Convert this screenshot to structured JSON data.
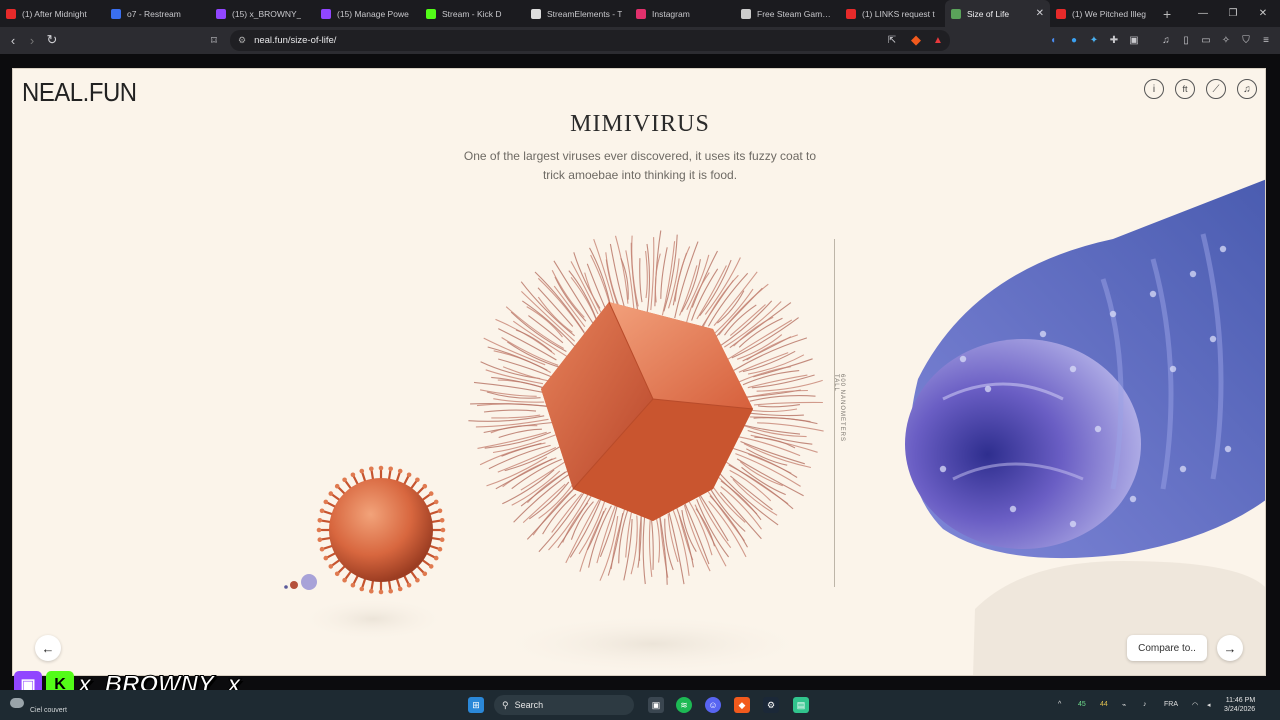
{
  "tabs": [
    {
      "label": "(1) After Midnight",
      "fav": "#e62a2a",
      "active": false
    },
    {
      "label": "o7 - Restream",
      "fav": "#3a6ff0",
      "active": false
    },
    {
      "label": "(15) x_BROWNY_",
      "fav": "#9146ff",
      "active": false
    },
    {
      "label": "(15) Manage Powe",
      "fav": "#9146ff",
      "active": false
    },
    {
      "label": "Stream - Kick D",
      "fav": "#53fc18",
      "active": false
    },
    {
      "label": "StreamElements - T",
      "fav": "#dddddd",
      "active": false
    },
    {
      "label": "Instagram",
      "fav": "#e1306c",
      "active": false
    },
    {
      "label": "Free Steam Game P",
      "fav": "#cccccc",
      "active": false
    },
    {
      "label": "(1) LINKS request t",
      "fav": "#e62a2a",
      "active": false
    },
    {
      "label": "Size of Life",
      "fav": "#5aa35a",
      "active": true
    },
    {
      "label": "(1) We Pitched Illeg",
      "fav": "#e62a2a",
      "active": false
    }
  ],
  "address": {
    "url": "neal.fun/size-of-life/"
  },
  "page": {
    "logo": "NEAL.FUN",
    "title": "MIMIVIRUS",
    "description": "One of the largest viruses ever discovered, it uses its fuzzy coat to trick amoebae into thinking it is food.",
    "scale_label": "600 NANOMETERS TALL",
    "compare_label": "Compare to..",
    "prev_icon": "←",
    "next_icon": "→"
  },
  "overlay": {
    "name": "x_BROWNY_x",
    "twitch_glyph": "▣",
    "kick_glyph": "K"
  },
  "taskbar": {
    "weather": "Ciel couvert",
    "search_label": "Search",
    "lang": "FRA",
    "time": "11:46 PM",
    "date": "3/24/2026",
    "tray_a": "45",
    "tray_b": "44"
  },
  "colors": {
    "accent_virus": "#e0714a",
    "mitochondria": "#5f63c8",
    "page_bg": "#fbf4ea"
  }
}
